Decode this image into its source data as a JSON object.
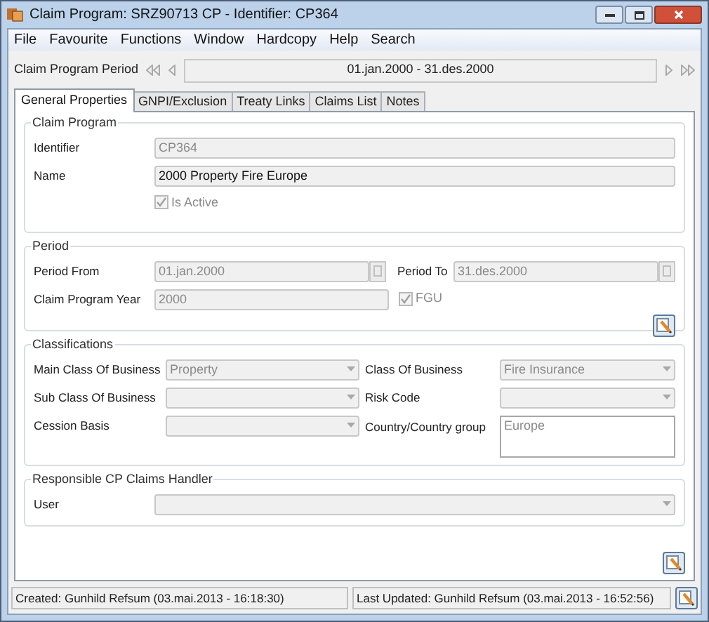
{
  "window": {
    "title": "Claim Program:  SRZ90713 CP - Identifier:  CP364"
  },
  "menu": [
    "File",
    "Favourite",
    "Functions",
    "Window",
    "Hardcopy",
    "Help",
    "Search"
  ],
  "period_bar": {
    "label": "Claim Program Period",
    "value": "01.jan.2000 - 31.des.2000"
  },
  "tabs": [
    {
      "label": "General Properties",
      "selected": true
    },
    {
      "label": "GNPI/Exclusion",
      "selected": false
    },
    {
      "label": "Treaty Links",
      "selected": false
    },
    {
      "label": "Claims List",
      "selected": false
    },
    {
      "label": "Notes",
      "selected": false
    }
  ],
  "claim_program": {
    "title": "Claim Program",
    "fields": [
      {
        "label": "Identifier",
        "value": "CP364",
        "disabled": true
      },
      {
        "label": "Name",
        "value": "2000 Property Fire Europe",
        "disabled": false
      }
    ],
    "is_active": {
      "label": "Is Active",
      "checked": true
    }
  },
  "period": {
    "title": "Period",
    "period_from": {
      "label": "Period From",
      "value": "01.jan.2000"
    },
    "period_to": {
      "label": "Period To",
      "value": "31.des.2000"
    },
    "year": {
      "label": "Claim Program Year",
      "value": "2000"
    },
    "fgu": {
      "label": "FGU",
      "checked": true
    }
  },
  "classifications": {
    "title": "Classifications",
    "left": [
      {
        "label": "Main Class Of Business",
        "value": "Property"
      },
      {
        "label": "Sub Class Of Business"
      },
      {
        "label": "Cession Basis"
      }
    ],
    "right": [
      {
        "label": "Class Of Business",
        "value": "Fire Insurance",
        "kind": "dropdown"
      },
      {
        "label": "Risk Code",
        "kind": "dropdown"
      },
      {
        "label": "Country/Country group",
        "value": "Europe",
        "kind": "textarea"
      }
    ]
  },
  "handler": {
    "title": "Responsible CP Claims Handler",
    "user": {
      "label": "User"
    }
  },
  "status_bar": {
    "created": "Created: Gunhild Refsum (03.mai.2013 - 16:18:30)",
    "updated": "Last Updated: Gunhild Refsum (03.mai.2013 - 16:52:56)"
  }
}
